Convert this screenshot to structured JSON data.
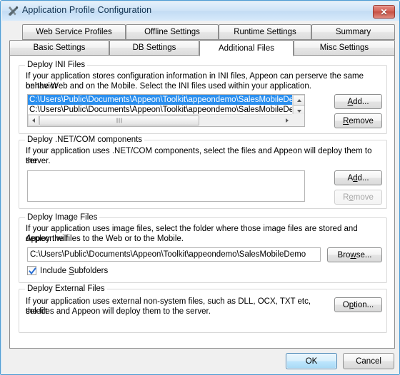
{
  "window": {
    "title": "Application Profile Configuration",
    "icon": "tools-icon",
    "close_label": "✕",
    "accent": "#4a9bd4",
    "titlebar_color": "#cfe4f7",
    "close_color": "#c44f44"
  },
  "tabs": {
    "row1": [
      {
        "label": "Web Service Profiles",
        "active": false
      },
      {
        "label": "Offline Settings",
        "active": false
      },
      {
        "label": "Runtime Settings",
        "active": false
      },
      {
        "label": "Summary",
        "active": false
      }
    ],
    "row2": [
      {
        "label": "Basic Settings",
        "active": false
      },
      {
        "label": "DB Settings",
        "active": false
      },
      {
        "label": "Additional Files",
        "active": true
      },
      {
        "label": "Misc Settings",
        "active": false
      }
    ]
  },
  "ini_group": {
    "title": "Deploy INI Files",
    "desc_line1": "If your application stores configuration information in INI files, Appeon can perserve the same behavior",
    "desc_line2": "on the Web and on the Mobile. Select the INI files used within your application.",
    "items": [
      {
        "path": "C:\\Users\\Public\\Documents\\Appeon\\Toolkit\\appeondemo\\SalesMobileDemo",
        "selected": true
      },
      {
        "path": "C:\\Users\\Public\\Documents\\Appeon\\Toolkit\\appeondemo\\SalesMobileDemo",
        "selected": false
      }
    ],
    "add_label": "Add...",
    "add_mnemonic": "A",
    "remove_label": "Remove",
    "remove_mnemonic": "R",
    "add_enabled": true,
    "remove_enabled": true,
    "selection_color": "#2a8fef"
  },
  "net_group": {
    "title": "Deploy .NET/COM components",
    "desc_line1": "If your application uses .NET/COM components, select the files and Appeon will deploy them to the",
    "desc_line2": "server.",
    "items": [],
    "add_label": "Add...",
    "add_mnemonic": "d",
    "remove_label": "Remove",
    "remove_mnemonic": "e",
    "add_enabled": true,
    "remove_enabled": false
  },
  "image_group": {
    "title": "Deploy Image Files",
    "desc_line1": "If your application uses image files, select the folder where those image files are stored and Appeon will",
    "desc_line2": "deploy the files to the Web or to the Mobile.",
    "path_value": "C:\\Users\\Public\\Documents\\Appeon\\Toolkit\\appeondemo\\SalesMobileDemo",
    "path_placeholder": "",
    "browse_label": "Browse...",
    "browse_mnemonic": "w",
    "checkbox_label": "Include Subfolders",
    "checkbox_mnemonic": "S",
    "checkbox_checked": true
  },
  "external_group": {
    "title": "Deploy External Files",
    "desc_line1": "If your application uses external non-system files, such as DLL, OCX, TXT etc, select",
    "desc_line2": "the files and Appeon will deploy them to the server.",
    "option_label": "Option...",
    "option_mnemonic": "p"
  },
  "footer": {
    "ok_label": "OK",
    "cancel_label": "Cancel",
    "default_button": "ok"
  }
}
